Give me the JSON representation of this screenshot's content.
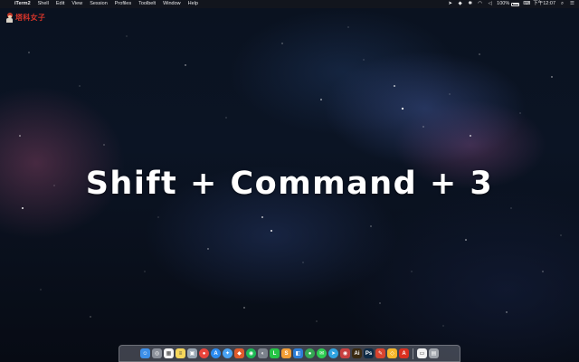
{
  "menubar": {
    "apple_glyph": "",
    "items": [
      "iTerm2",
      "Shell",
      "Edit",
      "View",
      "Session",
      "Profiles",
      "Toolbelt",
      "Window",
      "Help"
    ],
    "status": {
      "battery_percent": "100%",
      "clock": "下午12:07"
    }
  },
  "logo": {
    "text": "塔科女子"
  },
  "headline": {
    "text": "Shift + Command + 3"
  },
  "dock": {
    "apps": [
      {
        "name": "finder-icon",
        "color": "#3d8fe8",
        "glyph": "☺"
      },
      {
        "name": "launchpad-icon",
        "color": "#8a8f99",
        "glyph": "◎"
      },
      {
        "name": "calendar-icon",
        "color": "#f4f4f4",
        "glyph": "▦"
      },
      {
        "name": "notes-icon",
        "color": "#f5d65a",
        "glyph": "≡"
      },
      {
        "name": "preview-icon",
        "color": "#9aa7b3",
        "glyph": "▣"
      },
      {
        "name": "chrome-icon",
        "color": "#e8453c",
        "glyph": "●"
      },
      {
        "name": "app-store-icon",
        "color": "#2b8bf0",
        "glyph": "A"
      },
      {
        "name": "safari-icon",
        "color": "#4aa3f2",
        "glyph": "✦"
      },
      {
        "name": "app-icon",
        "color": "#e05b2b",
        "glyph": "◆"
      },
      {
        "name": "spotify-icon",
        "color": "#1db954",
        "glyph": "◉"
      },
      {
        "name": "app-icon",
        "color": "#7b828c",
        "glyph": "◐"
      },
      {
        "name": "line-icon",
        "color": "#26c446",
        "glyph": "L"
      },
      {
        "name": "sublime-text-icon",
        "color": "#f29d35",
        "glyph": "S"
      },
      {
        "name": "app-icon",
        "color": "#2c7dd6",
        "glyph": "◧"
      },
      {
        "name": "google-chrome-icon",
        "color": "#34a853",
        "glyph": "●"
      },
      {
        "name": "messages-icon",
        "color": "#2ecb52",
        "glyph": "✉"
      },
      {
        "name": "telegram-icon",
        "color": "#2fa4e0",
        "glyph": "➤"
      },
      {
        "name": "app-icon",
        "color": "#c73f3f",
        "glyph": "◉"
      },
      {
        "name": "illustrator-icon",
        "color": "#3a2a10",
        "glyph": "Ai"
      },
      {
        "name": "photoshop-icon",
        "color": "#0d2a45",
        "glyph": "Ps"
      },
      {
        "name": "app-icon",
        "color": "#d8432e",
        "glyph": "✎"
      },
      {
        "name": "sketch-icon",
        "color": "#f6b62a",
        "glyph": "◇"
      },
      {
        "name": "acrobat-icon",
        "color": "#d9301f",
        "glyph": "A"
      },
      {
        "name": "app-icon",
        "color": "#f2f2f2",
        "glyph": "▭"
      },
      {
        "name": "trash-icon",
        "color": "#9ea3aa",
        "glyph": "▤"
      }
    ]
  }
}
